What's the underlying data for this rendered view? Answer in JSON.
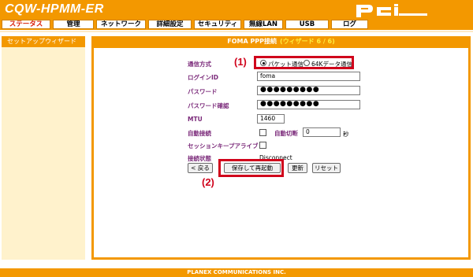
{
  "header": {
    "brand": "CQW-HPMM-ER",
    "logo_text": "PCi",
    "bg_color": "#f39800"
  },
  "nav": {
    "tabs": [
      {
        "label": "ステータス",
        "active": true
      },
      {
        "label": "管理"
      },
      {
        "label": "ネットワーク"
      },
      {
        "label": "詳細設定"
      },
      {
        "label": "セキュリティ"
      },
      {
        "label": "無線LAN"
      },
      {
        "label": "USB"
      },
      {
        "label": "ログ"
      }
    ]
  },
  "sidebar": {
    "items": [
      {
        "label": "セットアップウィザード"
      }
    ]
  },
  "panel": {
    "title": "FOMA PPP接続",
    "wizard": "(ウィザード 6 / 6)"
  },
  "form": {
    "comm_method": {
      "label": "通信方式",
      "options": [
        "パケット通信",
        "64Kデータ通信"
      ],
      "selected": "パケット通信"
    },
    "login_id": {
      "label": "ログインID",
      "value": "foma"
    },
    "password": {
      "label": "パスワード",
      "value": "●●●●●●●●●"
    },
    "password_confirm": {
      "label": "パスワード確認",
      "value": "●●●●●●●●●"
    },
    "mtu": {
      "label": "MTU",
      "value": "1460"
    },
    "auto_connect": {
      "label": "自動接続",
      "checked": false
    },
    "auto_disconnect": {
      "label": "自動切断",
      "value": "0",
      "unit": "秒"
    },
    "session_keepalive": {
      "label": "セッションキープアライブ",
      "checked": false
    },
    "conn_status": {
      "label": "接続状態",
      "value": "Disconnect"
    }
  },
  "buttons": {
    "back": "< 戻る",
    "save_restart": "保存して再起動",
    "refresh": "更新",
    "reset": "リセット"
  },
  "annotations": {
    "a1": "(1)",
    "a2": "(2)",
    "color": "#d0021b"
  },
  "footer": {
    "text": "PLANEX COMMUNICATIONS INC."
  }
}
